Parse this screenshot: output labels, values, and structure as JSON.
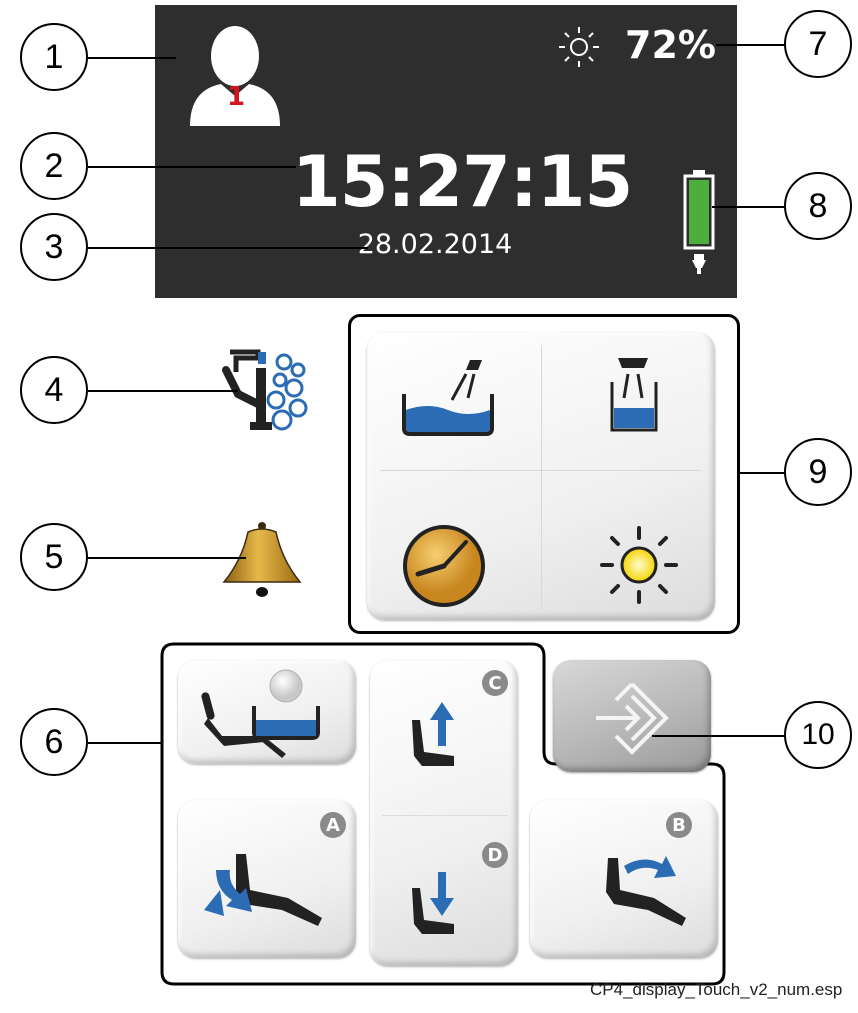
{
  "display": {
    "patient_number": "1",
    "time": "15:27:15",
    "date": "28.02.2014",
    "brightness": "72%",
    "battery_level": 1.0
  },
  "callouts": [
    "1",
    "2",
    "3",
    "4",
    "5",
    "6",
    "7",
    "8",
    "9",
    "10"
  ],
  "badges": {
    "a": "A",
    "b": "B",
    "c": "C",
    "d": "D"
  },
  "caption": "CP4_display_Touch_v2_num.esp",
  "icons": {
    "user": "user-icon",
    "sun": "brightness-sun-icon",
    "battery": "battery-icon",
    "foot_control": "foot-control-icon",
    "unit_clean": "cleaning-icon",
    "bell": "bell-icon",
    "basin_fill": "cup-fill-basin-icon",
    "cup_fill": "cup-fill-icon",
    "timer": "clock-timer-icon",
    "light": "operating-light-icon",
    "rinse_position": "rinse-position-icon",
    "chair_up": "chair-up-icon",
    "chair_down": "chair-down-icon",
    "backrest_back": "backrest-down-icon",
    "backrest_fwd": "backrest-up-icon",
    "entry_exit": "entry-exit-icon"
  },
  "colors": {
    "display_bg": "#2e2e2e",
    "accent_blue": "#2b6cb5",
    "battery_green": "#4caf3c",
    "patient_red": "#d4141b",
    "bell_gold": "#c8961e"
  }
}
